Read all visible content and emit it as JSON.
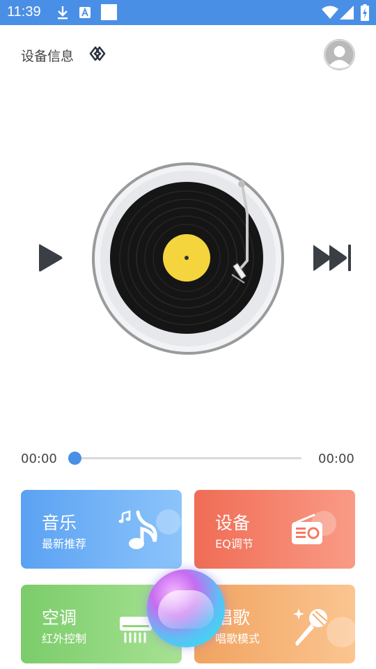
{
  "statusbar": {
    "time": "11:39"
  },
  "header": {
    "title": "设备信息"
  },
  "player": {
    "time_current": "00:00",
    "time_total": "00:00",
    "progress": 0
  },
  "cards": {
    "music": {
      "title": "音乐",
      "subtitle": "最新推荐"
    },
    "device": {
      "title": "设备",
      "subtitle": "EQ调节"
    },
    "ac": {
      "title": "空调",
      "subtitle": "红外控制"
    },
    "sing": {
      "title": "唱歌",
      "subtitle": "唱歌模式"
    }
  },
  "colors": {
    "accent": "#4a8fe6",
    "music_card": "#5aa2f2",
    "device_card": "#f06c55",
    "ac_card": "#7bcc6a",
    "sing_card": "#f0a35f",
    "vinyl_label": "#f5d53d"
  },
  "icons": [
    "download-icon",
    "a-notification-icon",
    "blank-notification-icon",
    "wifi-icon",
    "signal-icon",
    "battery-icon",
    "link-icon",
    "avatar-icon",
    "play-icon",
    "next-icon",
    "music-note-icon",
    "radio-icon",
    "air-conditioner-icon",
    "microphone-icon",
    "voice-assistant-icon"
  ]
}
